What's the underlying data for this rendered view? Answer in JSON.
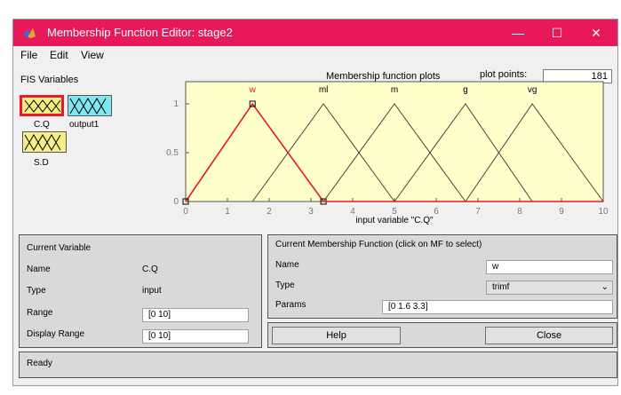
{
  "window": {
    "title": "Membership Function Editor: stage2",
    "minimize": "—",
    "maximize": "☐",
    "close": "✕",
    "icon": "matlab-icon"
  },
  "menu": [
    "File",
    "Edit",
    "View"
  ],
  "fis": {
    "title": "FIS Variables",
    "inputs": [
      {
        "label": "C.Q",
        "selected": true
      },
      {
        "label": "S.D",
        "selected": false
      }
    ],
    "outputs": [
      {
        "label": "output1"
      }
    ],
    "input_color": "#f5ef86",
    "output_color": "#7fe6f2",
    "selected_color": "#e8192c"
  },
  "plot": {
    "title": "Membership function plots",
    "plot_points_label": "plot points:",
    "plot_points": "181",
    "axis_label": "input variable \"C.Q\""
  },
  "chart_data": {
    "type": "line",
    "title": "Membership function plots",
    "xlabel": "input variable \"C.Q\"",
    "xlim": [
      0,
      10
    ],
    "ylim": [
      0,
      1
    ],
    "xticks": [
      0,
      1,
      2,
      3,
      4,
      5,
      6,
      7,
      8,
      9,
      10
    ],
    "yticks": [
      0,
      0.5,
      1
    ],
    "background": "#ffffcc",
    "series": [
      {
        "name": "w",
        "params": [
          0,
          1.6,
          3.3
        ],
        "selected": true,
        "color": "#e8192c"
      },
      {
        "name": "ml",
        "params": [
          1.6,
          3.3,
          5
        ],
        "selected": false,
        "color": "#444444"
      },
      {
        "name": "m",
        "params": [
          3.3,
          5,
          6.7
        ],
        "selected": false,
        "color": "#444444"
      },
      {
        "name": "g",
        "params": [
          5,
          6.7,
          8.3
        ],
        "selected": false,
        "color": "#444444"
      },
      {
        "name": "vg",
        "params": [
          6.7,
          8.3,
          10
        ],
        "selected": false,
        "color": "#444444"
      }
    ]
  },
  "current_variable": {
    "title": "Current Variable",
    "name_label": "Name",
    "name_value": "C.Q",
    "type_label": "Type",
    "type_value": "input",
    "range_label": "Range",
    "range_value": "[0 10]",
    "display_range_label": "Display Range",
    "display_range_value": "[0 10]"
  },
  "current_mf": {
    "title": "Current Membership Function (click on MF to select)",
    "name_label": "Name",
    "name_value": "w",
    "type_label": "Type",
    "type_value": "trimf",
    "params_label": "Params",
    "params_value": "[0 1.6 3.3]"
  },
  "buttons": {
    "help": "Help",
    "close": "Close"
  },
  "status": "Ready"
}
